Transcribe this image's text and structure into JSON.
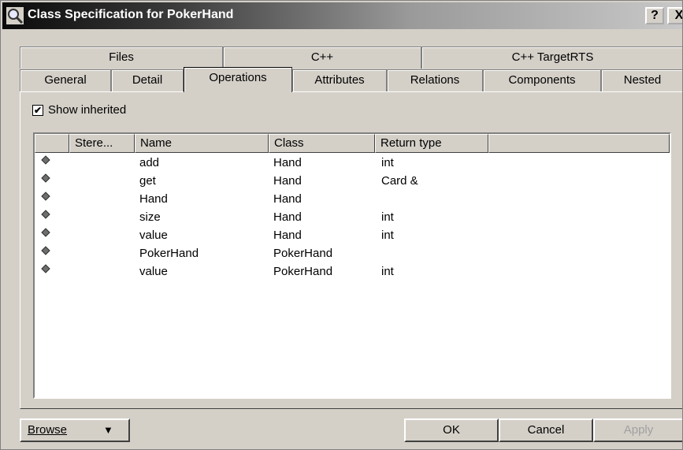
{
  "window": {
    "title": "Class Specification for PokerHand",
    "help_label": "?",
    "close_label": "X"
  },
  "tabs_back": [
    "Files",
    "C++",
    "C++ TargetRTS"
  ],
  "tabs_front": [
    "General",
    "Detail",
    "Operations",
    "Attributes",
    "Relations",
    "Components",
    "Nested"
  ],
  "active_tab": "Operations",
  "show_inherited": {
    "checked": true,
    "label": "Show inherited",
    "mark": "✔"
  },
  "columns": [
    "",
    "Stere...",
    "Name",
    "Class",
    "Return type",
    ""
  ],
  "rows": [
    {
      "stereotype": "",
      "name": "add",
      "class": "Hand",
      "return_type": "int"
    },
    {
      "stereotype": "",
      "name": "get",
      "class": "Hand",
      "return_type": "Card &"
    },
    {
      "stereotype": "",
      "name": "Hand",
      "class": "Hand",
      "return_type": ""
    },
    {
      "stereotype": "",
      "name": "size",
      "class": "Hand",
      "return_type": "int"
    },
    {
      "stereotype": "",
      "name": "value",
      "class": "Hand",
      "return_type": "int"
    },
    {
      "stereotype": "",
      "name": "PokerHand",
      "class": "PokerHand",
      "return_type": ""
    },
    {
      "stereotype": "",
      "name": "value",
      "class": "PokerHand",
      "return_type": "int"
    }
  ],
  "buttons": {
    "browse": "Browse",
    "browse_arrow": "▼",
    "ok": "OK",
    "cancel": "Cancel",
    "apply": "Apply"
  }
}
